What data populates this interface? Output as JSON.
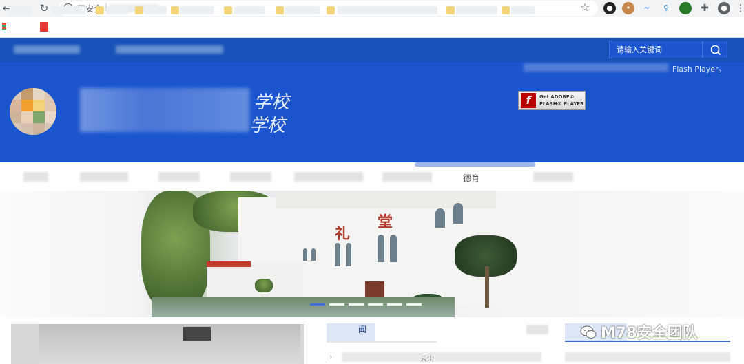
{
  "browser": {
    "address_security_label": "不安全",
    "address_separator": "|",
    "icons": [
      "back-icon",
      "forward-icon",
      "reload-icon",
      "info-icon",
      "star-icon",
      "extensions-icon",
      "profile-icon"
    ]
  },
  "site": {
    "search": {
      "placeholder": "请输入关键词"
    },
    "flash": {
      "line1": "Get ADOBE®",
      "line2": "FLASH® PLAYER",
      "note": "Flash Player。"
    },
    "school_name_suffix_1": "学校",
    "school_name_suffix_2": "学校",
    "nav": {
      "visible_label": "德育"
    },
    "hero": {
      "sign_char_1": "礼",
      "sign_char_2": "堂"
    },
    "news": {
      "tab_label": "闻",
      "row_suffix": "云山"
    },
    "watermark": "M78安全团队"
  },
  "colors": {
    "header_blue": "#1652b8",
    "banner_blue": "#1b55cd",
    "accent_blue": "#3b6fd6"
  }
}
